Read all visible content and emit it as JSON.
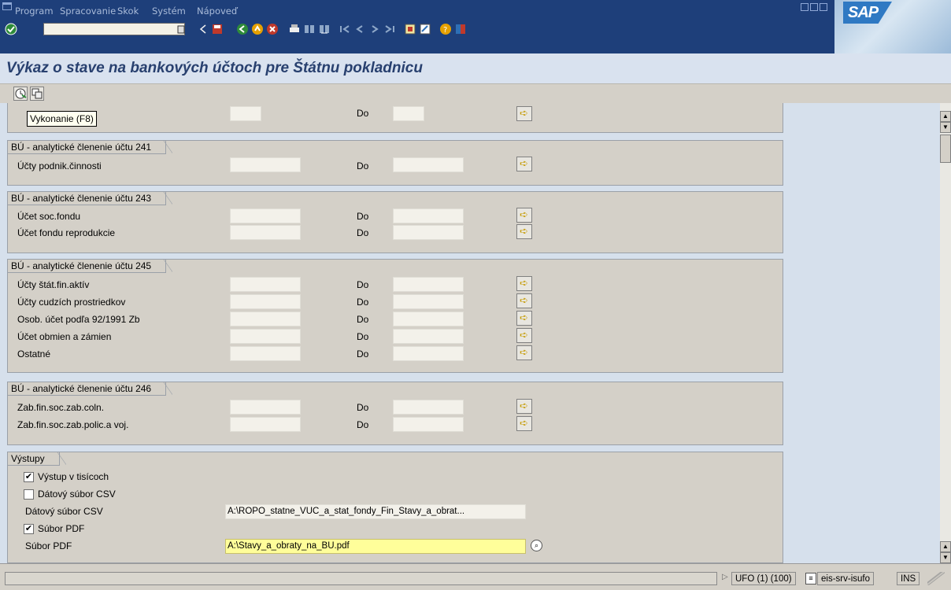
{
  "menu": {
    "items": [
      "Program",
      "Spracovanie",
      "Skok",
      "Systém",
      "Nápoveď"
    ]
  },
  "brand": {
    "logo_text": "SAP",
    "accent": "#1e3f7a"
  },
  "title": "Výkaz o stave na bankových účtoch pre Štátnu pokladnicu",
  "tooltip": "Vykonanie  (F8)",
  "do_label": "Do",
  "groups": [
    {
      "title": "",
      "rows": [
        {
          "label": ""
        }
      ]
    },
    {
      "title": "BÚ - analytické členenie účtu 241",
      "rows": [
        {
          "label": "Účty podnik.činnosti"
        }
      ]
    },
    {
      "title": "BÚ - analytické členenie účtu 243",
      "rows": [
        {
          "label": "Účet soc.fondu"
        },
        {
          "label": "Účet fondu reprodukcie"
        }
      ]
    },
    {
      "title": "BÚ - analytické členenie účtu 245",
      "rows": [
        {
          "label": "Účty štát.fin.aktív"
        },
        {
          "label": "Účty cudzích prostriedkov"
        },
        {
          "label": "Osob. účet podľa 92/1991 Zb"
        },
        {
          "label": "Účet obmien a zámien"
        },
        {
          "label": "Ostatné"
        }
      ]
    },
    {
      "title": "BÚ - analytické členenie účtu 246",
      "rows": [
        {
          "label": "Zab.fin.soc.zab.coln."
        },
        {
          "label": "Zab.fin.soc.zab.polic.a voj."
        }
      ]
    }
  ],
  "outputs": {
    "title": "Výstupy",
    "chk_thousands": "Výstup v tisícoch",
    "chk_thousands_checked": true,
    "chk_csv": "Dátový súbor CSV",
    "chk_csv_checked": false,
    "csv_label": "Dátový súbor CSV",
    "csv_value": "A:\\ROPO_statne_VUC_a_stat_fondy_Fin_Stavy_a_obrat...",
    "chk_pdf": "Súbor PDF",
    "chk_pdf_checked": true,
    "pdf_label": "Súbor PDF",
    "pdf_value": "A:\\Stavy_a_obraty_na_BU.pdf"
  },
  "status": {
    "system": "UFO (1) (100)",
    "server": "eis-srv-isufo",
    "mode": "INS"
  }
}
